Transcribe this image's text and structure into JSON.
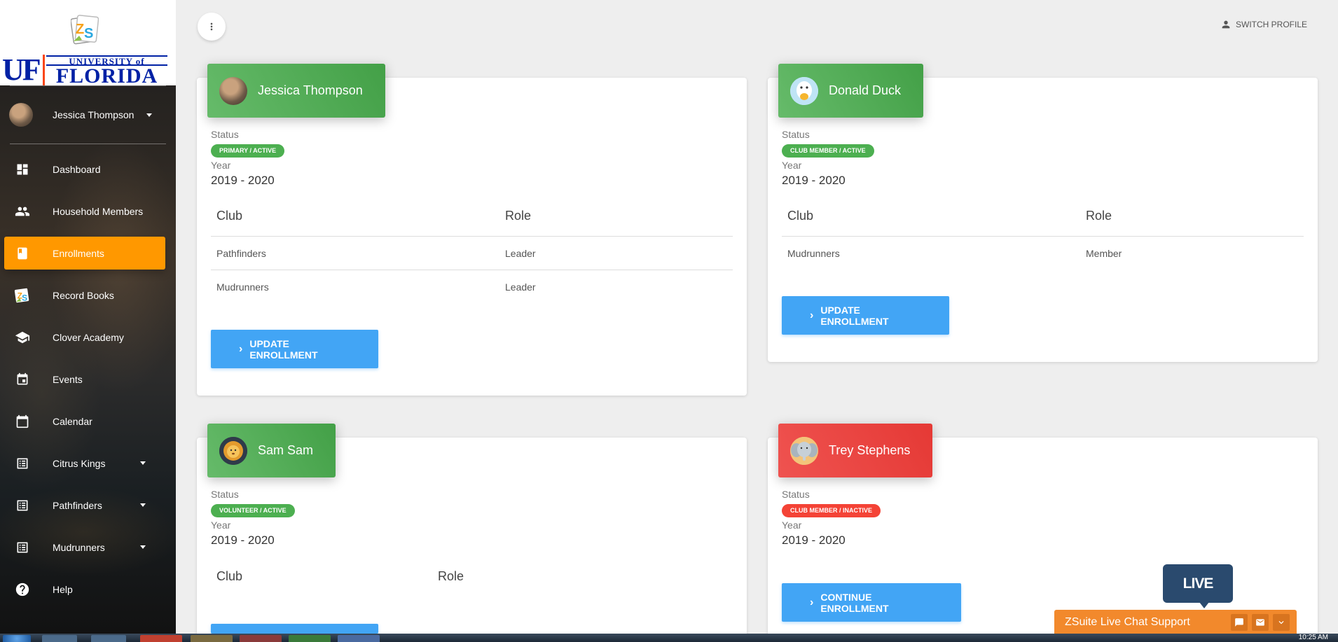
{
  "sidebar": {
    "user_name": "Jessica Thompson",
    "university_top": "UNIVERSITY of",
    "university_bottom": "FLORIDA",
    "uf_mark": "UF",
    "items": [
      {
        "label": "Dashboard",
        "icon": "dashboard-icon"
      },
      {
        "label": "Household Members",
        "icon": "people-icon"
      },
      {
        "label": "Enrollments",
        "icon": "book-icon",
        "active": true
      },
      {
        "label": "Record Books",
        "icon": "zs-logo-icon"
      },
      {
        "label": "Clover Academy",
        "icon": "school-icon"
      },
      {
        "label": "Events",
        "icon": "event-icon"
      },
      {
        "label": "Calendar",
        "icon": "calendar-icon"
      },
      {
        "label": "Citrus Kings",
        "icon": "list-icon",
        "expandable": true
      },
      {
        "label": "Pathfinders",
        "icon": "list-icon",
        "expandable": true
      },
      {
        "label": "Mudrunners",
        "icon": "list-icon",
        "expandable": true
      },
      {
        "label": "Help",
        "icon": "help-icon"
      }
    ]
  },
  "header": {
    "switch_profile": "SWITCH PROFILE"
  },
  "labels": {
    "status": "Status",
    "year": "Year",
    "club": "Club",
    "role": "Role"
  },
  "cards": [
    {
      "name": "Jessica Thompson",
      "status": "PRIMARY / ACTIVE",
      "year": "2019 - 2020",
      "rows": [
        {
          "club": "Pathfinders",
          "role": "Leader"
        },
        {
          "club": "Mudrunners",
          "role": "Leader"
        }
      ],
      "button": "UPDATE ENROLLMENT"
    },
    {
      "name": "Donald Duck",
      "status": "CLUB MEMBER / ACTIVE",
      "year": "2019 - 2020",
      "rows": [
        {
          "club": "Mudrunners",
          "role": "Member"
        }
      ],
      "button": "UPDATE ENROLLMENT"
    },
    {
      "name": "Sam Sam",
      "status": "VOLUNTEER / ACTIVE",
      "year": "2019 - 2020",
      "rows": []
    },
    {
      "name": "Trey Stephens",
      "status": "CLUB MEMBER / INACTIVE",
      "year": "2019 - 2020",
      "button": "CONTINUE ENROLLMENT"
    }
  ],
  "chat": {
    "bubble": "LIVE CHAT",
    "bar_label": "ZSuite Live Chat Support"
  },
  "taskbar": {
    "clock": "10:25 AM"
  },
  "colors": {
    "accent_orange": "#ff9800",
    "green_header": "#4caf50",
    "red_header": "#e53935",
    "button_blue": "#42a5f5",
    "chat_orange": "#f2892c",
    "chat_navy": "#2a4a6e"
  }
}
